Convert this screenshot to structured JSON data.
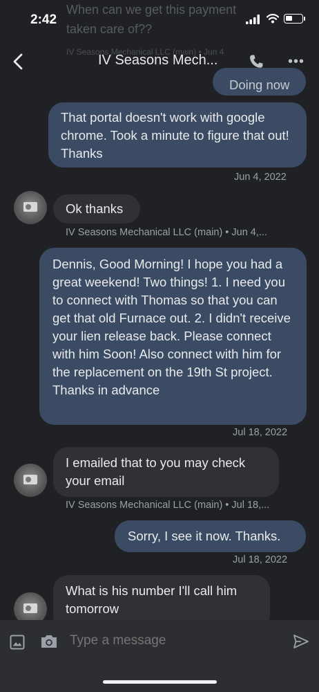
{
  "status": {
    "time": "2:42",
    "ghost_line1": "When can we get this payment",
    "ghost_line2": "taken care of??",
    "ghost_line3": "IV Seasons Mechanical LLC (main) • Jun 4"
  },
  "header": {
    "title": "IV Seasons Mech...",
    "back_icon": "chevron-left-icon",
    "call_icon": "phone-icon",
    "more_icon": "more-horizontal-icon"
  },
  "messages": [
    {
      "direction": "out",
      "text": "Doing now"
    },
    {
      "direction": "out",
      "text": "That portal doesn't work with google chrome. Took a minute to figure that out! Thanks",
      "meta": "Jun 4, 2022"
    },
    {
      "direction": "in",
      "text": "Ok thanks",
      "meta": "IV Seasons Mechanical LLC (main) • Jun 4,..."
    },
    {
      "direction": "out",
      "text": "Dennis, Good Morning! I hope you had a great weekend! Two things! 1. I need you to connect with Thomas so that you can get that old Furnace out. 2. I didn't receive your lien release back. Please connect with him Soon! Also connect with him for the replacement on the 19th St project.  Thanks in advance",
      "meta": "Jul 18, 2022"
    },
    {
      "direction": "in",
      "text": "I emailed that to you may check your email",
      "meta": "IV Seasons Mechanical LLC (main) • Jul 18,..."
    },
    {
      "direction": "out",
      "text": "Sorry, I see it now. Thanks.",
      "meta": "Jul 18, 2022"
    },
    {
      "direction": "in",
      "text": "What is his number I'll call him tomorrow"
    }
  ],
  "composer": {
    "placeholder": "Type a message",
    "attach_image_icon": "image-icon",
    "camera_icon": "camera-icon",
    "send_icon": "send-icon"
  },
  "colors": {
    "background": "#202124",
    "outgoing_bubble": "#3b4b63",
    "incoming_bubble": "#303134",
    "meta_text": "#9aa0a6"
  }
}
